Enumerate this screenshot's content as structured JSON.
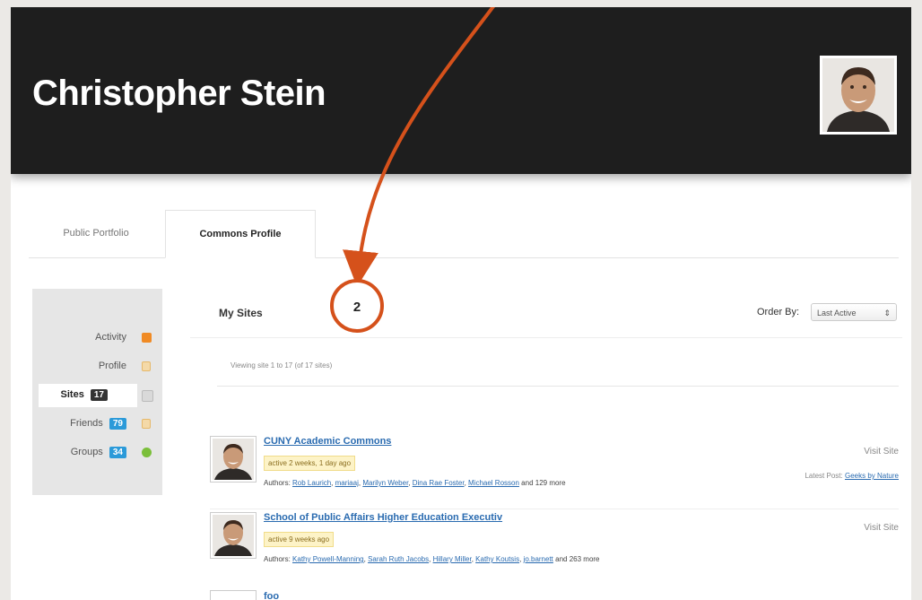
{
  "header": {
    "name": "Christopher Stein"
  },
  "tabs": [
    {
      "label": "Public Portfolio",
      "active": false
    },
    {
      "label": "Commons Profile",
      "active": true
    }
  ],
  "sidebar": {
    "items": [
      {
        "label": "Activity",
        "count": null,
        "icon": "rss-icon"
      },
      {
        "label": "Profile",
        "count": null,
        "icon": "lock-icon"
      },
      {
        "label": "Sites",
        "count": "17",
        "icon": "page-icon",
        "current": true
      },
      {
        "label": "Friends",
        "count": "79",
        "icon": "lock-icon"
      },
      {
        "label": "Groups",
        "count": "34",
        "icon": "cube-icon"
      }
    ]
  },
  "main": {
    "title": "My Sites",
    "order_label": "Order By:",
    "order_value": "Last Active",
    "viewing": "Viewing site 1 to 17 (of 17 sites)"
  },
  "sites": [
    {
      "name": "CUNY Academic Commons",
      "active": "active 2 weeks, 1 day ago",
      "authors_prefix": "Authors:",
      "authors": [
        "Rob Laurich",
        "mariaaj",
        "Marilyn Weber",
        "Dina Rae Foster",
        "Michael Rosson"
      ],
      "authors_suffix": "and 129 more",
      "visit": "Visit Site",
      "latest_label": "Latest Post:",
      "latest_post": "Geeks by Nature"
    },
    {
      "name": "School of Public Affairs Higher Education Executiv",
      "active": "active 9 weeks ago",
      "authors_prefix": "Authors:",
      "authors": [
        "Kathy Powell-Manning",
        "Sarah Ruth Jacobs",
        "Hillary Miller",
        "Kathy Koutsis",
        "jo.barnett"
      ],
      "authors_suffix": "and 263 more",
      "visit": "Visit Site"
    },
    {
      "name": "foo"
    }
  ],
  "annotation": {
    "label": "2"
  },
  "colors": {
    "header_bg": "#1e1e1e",
    "link": "#2a6bb0",
    "annotation": "#d5511b",
    "badge_blue": "#2b9ad9",
    "badge_dark": "#333333"
  }
}
